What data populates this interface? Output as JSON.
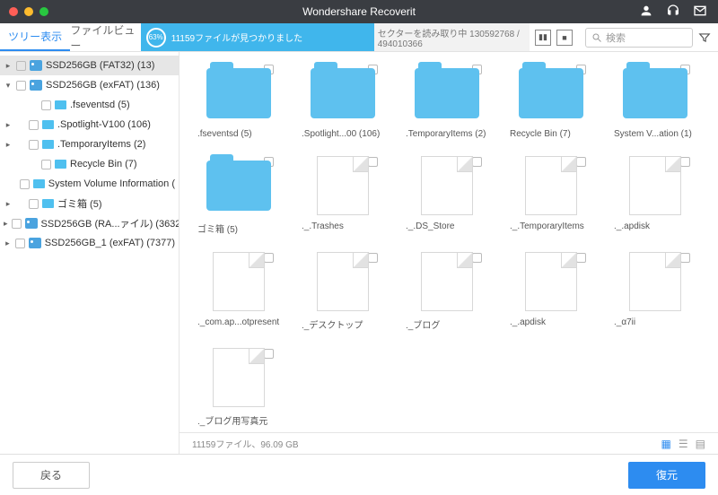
{
  "title": "Wondershare Recoverit",
  "tabs": {
    "tree": "ツリー表示",
    "file": "ファイルビュー"
  },
  "scan": {
    "percent": "63%",
    "found": "11159ファイルが見つかりました",
    "sector": "セクターを読み取り中 130592768 / 494010366"
  },
  "search": {
    "placeholder": "検索"
  },
  "sidebar": [
    {
      "indent": 0,
      "chev": "▸",
      "icon": "drive",
      "label": "SSD256GB (FAT32) (13)",
      "selected": true
    },
    {
      "indent": 0,
      "chev": "▾",
      "icon": "drive",
      "label": "SSD256GB (exFAT) (136)"
    },
    {
      "indent": 2,
      "chev": "",
      "icon": "folder",
      "label": ".fseventsd (5)"
    },
    {
      "indent": 1,
      "chev": "▸",
      "icon": "folder",
      "label": ".Spotlight-V100 (106)"
    },
    {
      "indent": 1,
      "chev": "▸",
      "icon": "folder",
      "label": ".TemporaryItems (2)"
    },
    {
      "indent": 2,
      "chev": "",
      "icon": "folder",
      "label": "Recycle Bin (7)"
    },
    {
      "indent": 2,
      "chev": "",
      "icon": "folder",
      "label": "System Volume Information ("
    },
    {
      "indent": 1,
      "chev": "▸",
      "icon": "folder",
      "label": "ゴミ箱 (5)"
    },
    {
      "indent": 0,
      "chev": "▸",
      "icon": "drive",
      "label": "SSD256GB (RA...ァイル) (3632"
    },
    {
      "indent": 0,
      "chev": "▸",
      "icon": "drive",
      "label": "SSD256GB_1 (exFAT) (7377)"
    }
  ],
  "grid": [
    {
      "type": "folder",
      "label": ".fseventsd (5)"
    },
    {
      "type": "folder",
      "label": ".Spotlight...00 (106)"
    },
    {
      "type": "folder",
      "label": ".TemporaryItems (2)"
    },
    {
      "type": "folder",
      "label": "Recycle Bin (7)"
    },
    {
      "type": "folder",
      "label": "System V...ation (1)"
    },
    {
      "type": "folder",
      "label": "ゴミ箱 (5)"
    },
    {
      "type": "file",
      "label": "._.Trashes"
    },
    {
      "type": "file",
      "label": "._.DS_Store"
    },
    {
      "type": "file",
      "label": "._.TemporaryItems"
    },
    {
      "type": "file",
      "label": "._.apdisk"
    },
    {
      "type": "file",
      "label": "._com.ap...otpresent"
    },
    {
      "type": "file",
      "label": "._デスクトップ"
    },
    {
      "type": "file",
      "label": "._ブログ"
    },
    {
      "type": "file",
      "label": "._.apdisk"
    },
    {
      "type": "file",
      "label": "._α7ii"
    },
    {
      "type": "file",
      "label": "._ブログ用写真元"
    }
  ],
  "status": "11159ファイル、96.09 GB",
  "footer": {
    "back": "戻る",
    "recover": "復元"
  }
}
